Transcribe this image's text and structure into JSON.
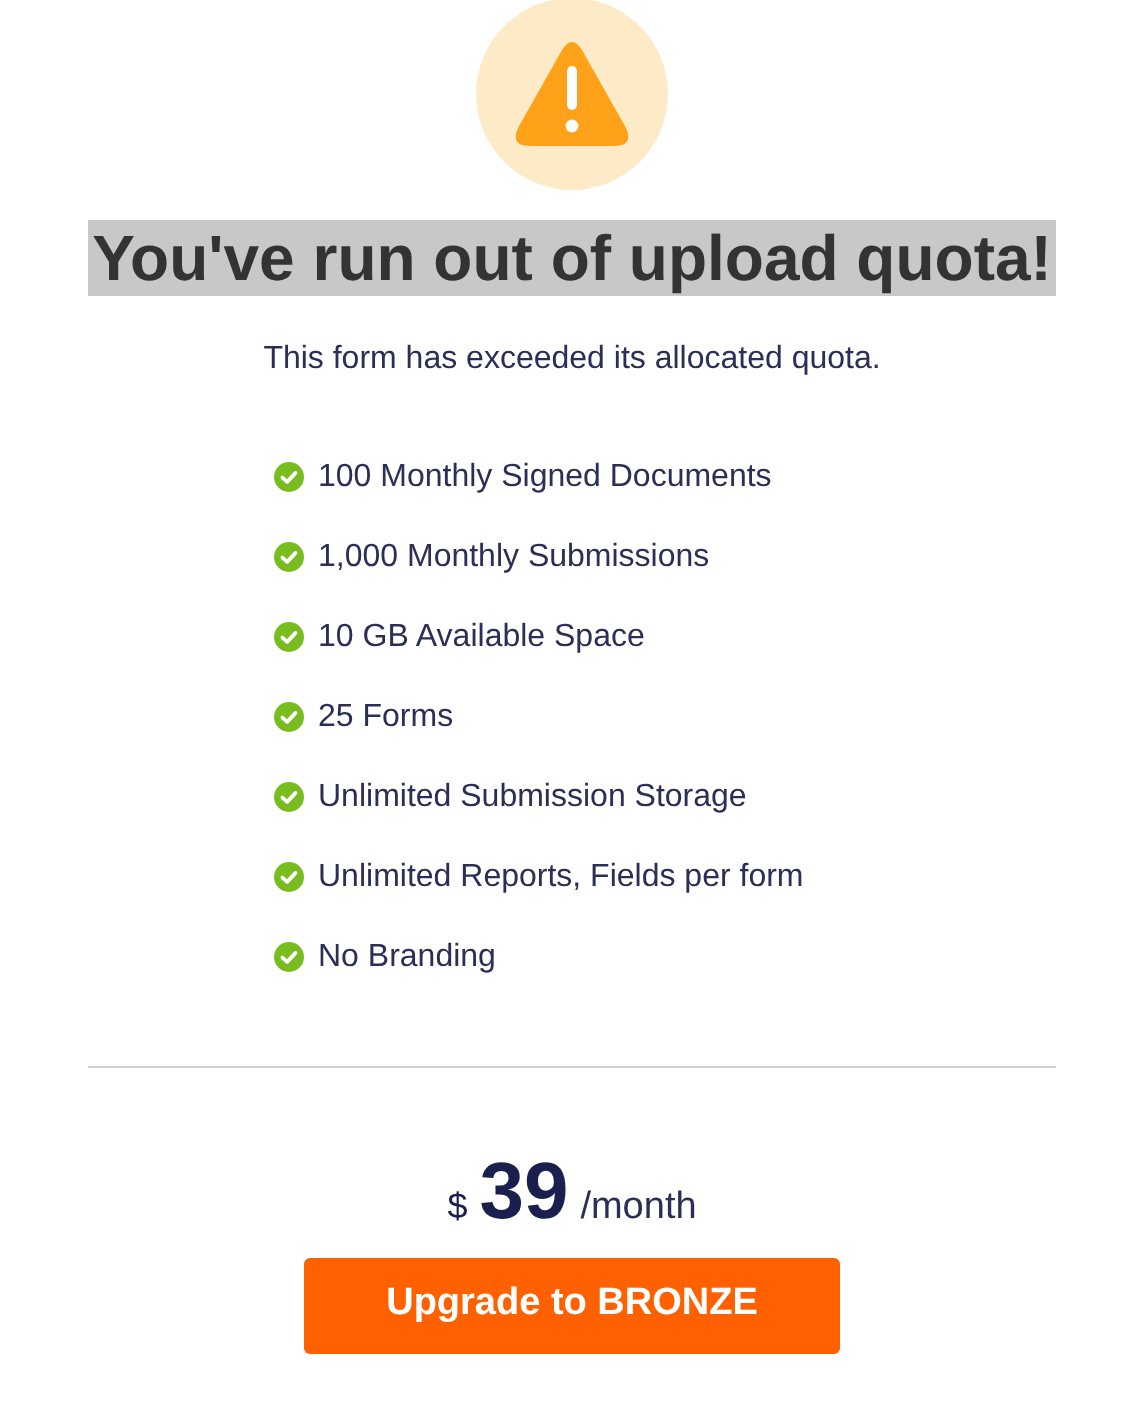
{
  "heading": {
    "text": "You've run out of upload quota!",
    "highlighted": true
  },
  "message": "This form has exceeded its allocated quota.",
  "features": [
    {
      "label": "100 Monthly Signed Documents",
      "included": true
    },
    {
      "label": "1,000 Monthly Submissions",
      "included": true
    },
    {
      "label": "10 GB Available Space",
      "included": true
    },
    {
      "label": "25 Forms",
      "included": true
    },
    {
      "label": "Unlimited Submission Storage",
      "included": true
    },
    {
      "label": "Unlimited Reports, Fields per form",
      "included": true
    },
    {
      "label": "No Branding",
      "included": true
    }
  ],
  "price": {
    "currency": "$",
    "amount": "39",
    "period": "/month"
  },
  "upgrade_button": "Upgrade to BRONZE"
}
